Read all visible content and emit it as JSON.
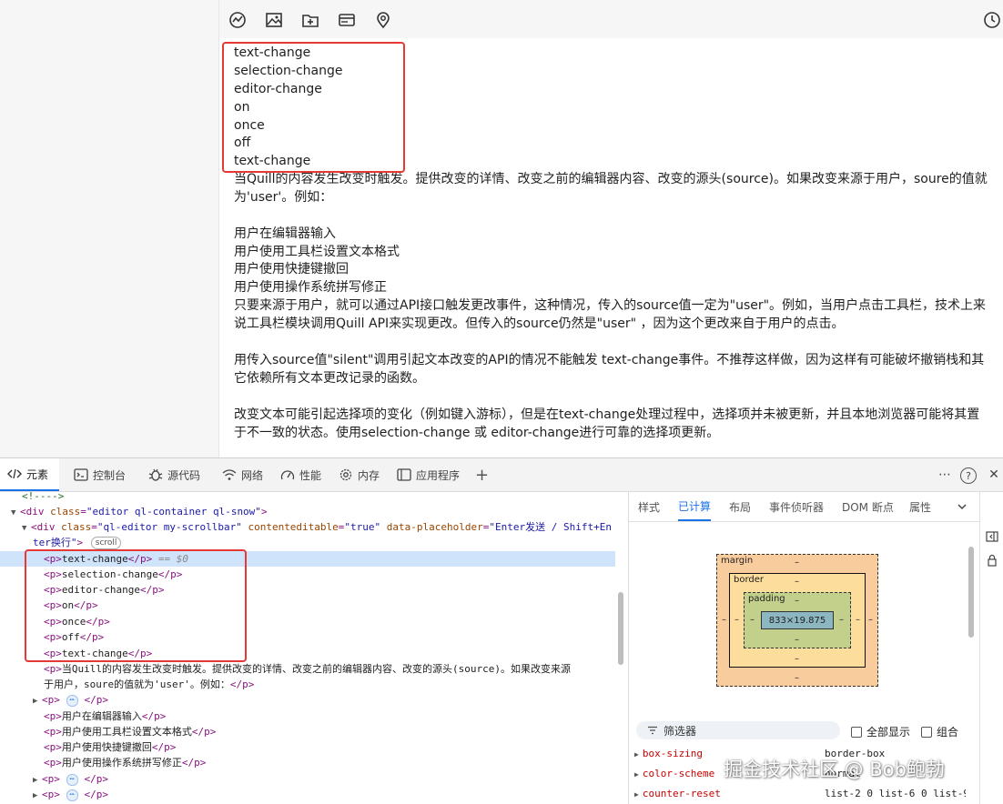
{
  "editor": {
    "toolbar_icons": [
      "chart-icon",
      "image-icon",
      "folder-plus-icon",
      "card-icon",
      "location-icon",
      "clock-icon"
    ],
    "event_lines": [
      "text-change",
      "selection-change",
      "editor-change",
      "on",
      "once",
      "off",
      "text-change"
    ],
    "paragraphs": [
      "当Quill的内容发生改变时触发。提供改变的详情、改变之前的编辑器内容、改变的源头(source)。如果改变来源于用户，soure的值就为'user'。例如：",
      "用户在编辑器输入",
      "用户使用工具栏设置文本格式",
      "用户使用快捷键撤回",
      "用户使用操作系统拼写修正",
      "只要来源于用户，就可以通过API接口触发更改事件，这种情况，传入的source值一定为\"user\"。例如，当用户点击工具栏，技术上来说工具栏模块调用Quill API来实现更改。但传入的source仍然是\"user\" ，因为这个更改来自于用户的点击。",
      "用传入source值\"silent\"调用引起文本改变的API的情况不能触发 text-change事件。不推荐这样做，因为这样有可能破坏撤销栈和其它依赖所有文本更改记录的函数。",
      "改变文本可能引起选择项的变化（例如键入游标），但是在text-change处理过程中，选择项并未被更新，并且本地浏览器可能将其置于不一致的状态。使用selection-change 或 editor-change进行可靠的选择项更新。"
    ]
  },
  "devtools": {
    "tabs": [
      "元素",
      "控制台",
      "源代码",
      "网络",
      "性能",
      "内存",
      "应用程序"
    ],
    "tab_icons": [
      "code-icon",
      "console-icon",
      "bug-icon",
      "wifi-icon",
      "gauge-icon",
      "gear-icon",
      "app-icon"
    ],
    "add_tab": "+",
    "right_controls": [
      "⋯",
      "?",
      "✕"
    ],
    "elements": {
      "comment": "<!---->",
      "container_open": "div",
      "container_class_attr": "class",
      "container_class": "\"editor ql-container ql-snow\"",
      "editor_div": "div",
      "editor_attr_class": "class",
      "editor_class": "\"ql-editor my-scrollbar\"",
      "editor_attr_ce": "contenteditable",
      "editor_ce": "\"true\"",
      "editor_attr_ph": "data-placeholder",
      "editor_ph_part1": "\"Enter发送 / Shift+En",
      "editor_ph_part2": "ter换行\"",
      "scroll_badge": "scroll",
      "selected_marker": "== $0",
      "p_lines": [
        "text-change",
        "selection-change",
        "editor-change",
        "on",
        "once",
        "off",
        "text-change"
      ],
      "long_p_line1": "当Quill的内容发生改变时触发。提供改变的详情、改变之前的编辑器内容、改变的源头(source)。如果改变来源",
      "long_p_line2": "于用户，soure的值就为'user'。例如：",
      "collapsed_ellipsis": "⋯",
      "user_lines": [
        "用户在编辑器输入",
        "用户使用工具栏设置文本格式",
        "用户使用快捷键撤回",
        "用户使用操作系统拼写修正"
      ]
    },
    "side_tabs": [
      "样式",
      "已计算",
      "布局",
      "事件侦听器",
      "DOM 断点",
      "属性"
    ],
    "box_model": {
      "margin_label": "margin",
      "border_label": "border",
      "padding_label": "padding",
      "dash": "–",
      "content_size": "833×19.875"
    },
    "filter": {
      "placeholder": "筛选器",
      "show_all": "全部显示",
      "group": "组合"
    },
    "computed": [
      {
        "name": "box-sizing",
        "value": "border-box"
      },
      {
        "name": "color-scheme",
        "value": "normal"
      },
      {
        "name": "counter-reset",
        "value": "list-2 0 list-6 0 list-9"
      }
    ],
    "colors": {
      "accent": "#1a73e8",
      "highlight_box": "#e53935",
      "selected_row": "#cfe3fb"
    }
  },
  "watermark": "掘金技术社区 @ Bob鲍勃"
}
